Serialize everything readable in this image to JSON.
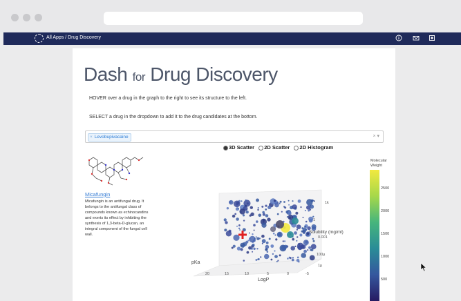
{
  "appbar": {
    "breadcrumb": "All Apps / Drug Discovery",
    "icons": [
      "info-icon",
      "mail-icon",
      "window-icon"
    ]
  },
  "page": {
    "title_main": "Dash ",
    "title_for": "for",
    "title_rest": " Drug Discovery",
    "instruction_hover": "HOVER over a drug in the graph to the right to see its structure to the left.",
    "instruction_select": "SELECT a drug in the dropdown to add it to the drug candidates at the bottom."
  },
  "dropdown": {
    "selected": "Levobupivacaine",
    "remove_glyph": "×",
    "clear_glyph": "×",
    "arrow_glyph": "▾"
  },
  "plot_options": {
    "selected": "3D Scatter",
    "options": [
      "3D Scatter",
      "2D Scatter",
      "2D Histogram"
    ]
  },
  "drug": {
    "name": "Micafungin",
    "description": "Micafungin is an antifungal drug. It belongs to the antifungal class of compounds known as echinocandins and exerts its effect by inhibiting the synthesis of 1,3-beta-D-glucan, an integral component of the fungal cell wall."
  },
  "chart_data": {
    "type": "scatter",
    "title": "",
    "axes": {
      "x": {
        "label": "LogP",
        "ticks": [
          "20",
          "15",
          "10",
          "5",
          "0",
          "-5"
        ]
      },
      "y": {
        "label": "pKa",
        "ticks": []
      },
      "z": {
        "label": "Solubility (mg/ml)",
        "ticks": [
          "1k",
          "1",
          "0.001",
          "100µ",
          "1µ"
        ]
      }
    },
    "colorbar": {
      "title": "Molecular Weight",
      "ticks": [
        2500,
        2000,
        1500,
        1000,
        500
      ],
      "range": [
        0,
        3000
      ]
    },
    "colors": {
      "low": "#271b62",
      "mid": "#2a8c97",
      "high": "#f2e93f",
      "highlight": "#e0201f"
    }
  }
}
